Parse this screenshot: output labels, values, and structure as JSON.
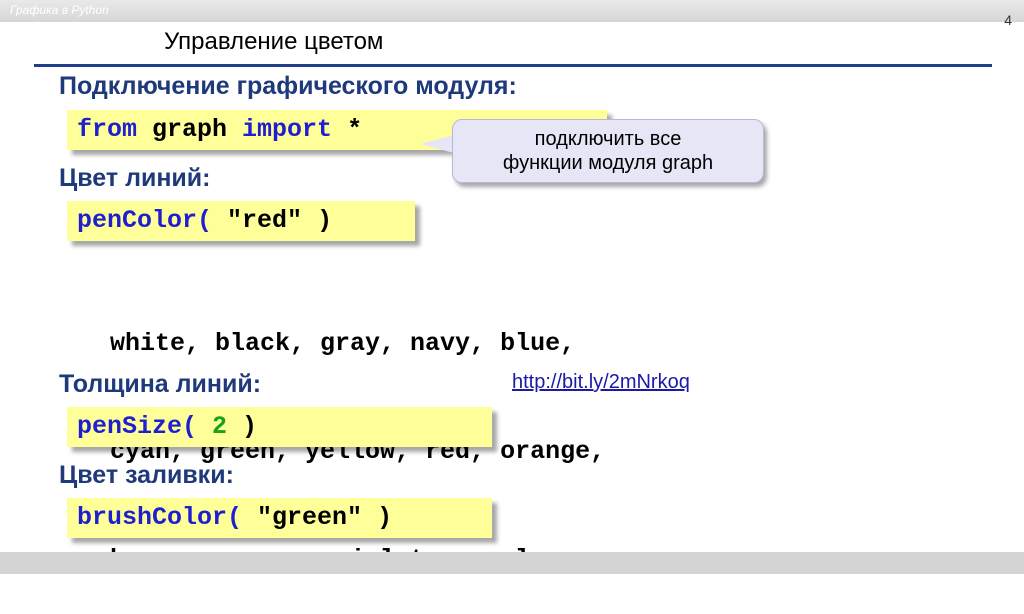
{
  "header": {
    "title": "Графика в Python",
    "page_number": "4"
  },
  "slide_title": "Управление цветом",
  "sections": {
    "module": {
      "heading": "Подключение графического модуля:"
    },
    "pen_color": {
      "heading": "Цвет линий:"
    },
    "pen_size": {
      "heading": "Толщина линий:"
    },
    "brush": {
      "heading": "Цвет заливки:"
    }
  },
  "code": {
    "import_from": "from",
    "import_module": " graph ",
    "import_kw": "import",
    "import_star": " *",
    "pen_color_func": "penColor(",
    "pen_color_arg": " \"red\" ",
    "pen_color_close": ")",
    "pen_size_func": "penSize(",
    "pen_size_arg": " 2 ",
    "pen_size_close": ")",
    "brush_func": "brushColor(",
    "brush_arg": " \"green\" ",
    "brush_close": ")"
  },
  "callout": {
    "line1": "подключить все",
    "line2": "функции модуля graph"
  },
  "color_list": [
    "white, black, gray, navy, blue,",
    "cyan, green, yellow, red, orange,",
    "brown, maroon, violet, purple, ..."
  ],
  "link": {
    "text": "http://bit.ly/2mNrkoq"
  },
  "colors": {
    "heading": "#1f3a7a",
    "code_bg": "#ffff99",
    "keyword": "#1f1fd0",
    "number": "#1aa01a",
    "link": "#1a1aa6"
  }
}
